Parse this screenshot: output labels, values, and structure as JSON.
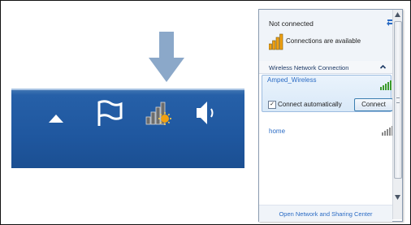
{
  "popup": {
    "status_title": "Not connected",
    "connections_text": "Connections are available",
    "section_label": "Wireless Network Connection",
    "networks": [
      {
        "name": "Amped_Wireless",
        "signal_icon": "signal-strength-full-icon"
      },
      {
        "name": "home",
        "signal_icon": "signal-strength-full-icon"
      }
    ],
    "connect_automatically_label": "Connect automatically",
    "connect_automatically_checked": "✓",
    "connect_button_label": "Connect",
    "footer_link": "Open Network and Sharing Center"
  },
  "taskbar": {
    "icons": [
      "show-hidden-icons-arrow-icon",
      "action-center-flag-icon",
      "wireless-network-available-icon",
      "volume-speaker-icon"
    ]
  },
  "colors": {
    "taskbar": "#1f579f",
    "arrow": "#8ba8c9",
    "link": "#2a6bc4",
    "signal_green": "#3a9a2a",
    "wireless_orange": "#f0a010"
  }
}
